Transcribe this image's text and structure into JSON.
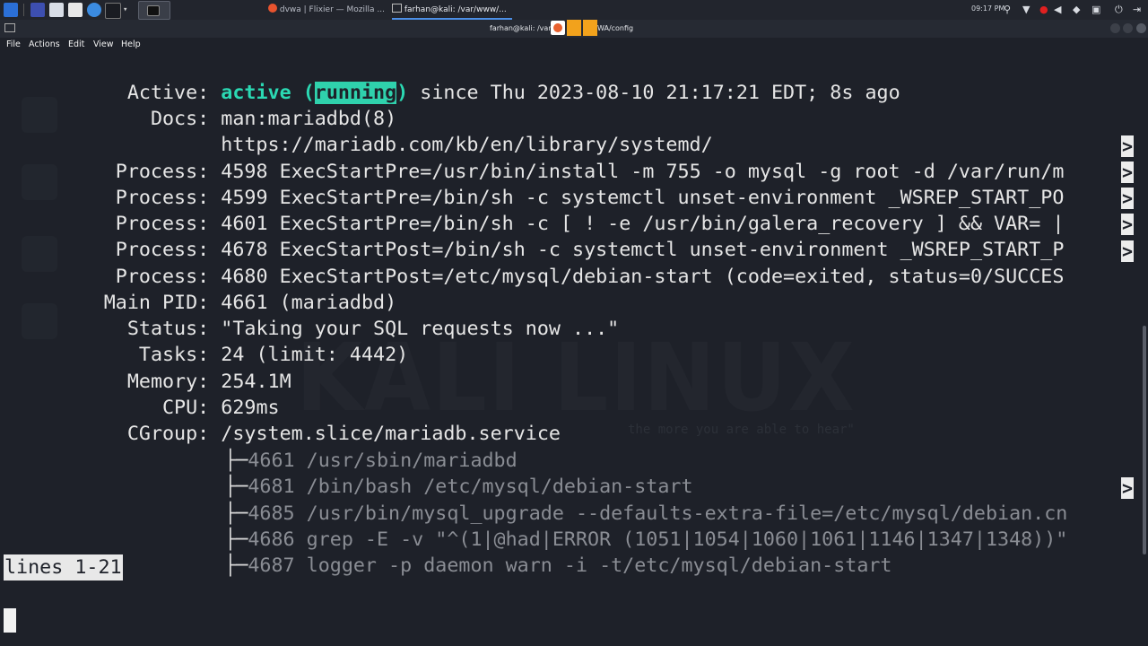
{
  "taskbar": {
    "tasks": [
      {
        "label": "dvwa | Flixier — Mozilla ..."
      },
      {
        "label": "farhan@kali: /var/www/..."
      }
    ],
    "clock": "09:17 PM"
  },
  "window": {
    "title_left": "farhan@kali: /var/",
    "title_right": "WA/config"
  },
  "menu": {
    "items": [
      "File",
      "Actions",
      "Edit",
      "View",
      "Help"
    ]
  },
  "terminal": {
    "active": {
      "key": "Active:",
      "state": "active",
      "paren_open": "(",
      "running": "running",
      "paren_close": ")",
      "rest": " since Thu 2023-08-10 21:17:21 EDT; 8s ago"
    },
    "docs": {
      "key": "Docs:",
      "value": "man:mariadbd(8)"
    },
    "docs_url": "https://mariadb.com/kb/en/library/systemd/",
    "processes": [
      {
        "key": "Process:",
        "value": "4598 ExecStartPre=/usr/bin/install -m 755 -o mysql -g root -d /var/run/m"
      },
      {
        "key": "Process:",
        "value": "4599 ExecStartPre=/bin/sh -c systemctl unset-environment _WSREP_START_PO"
      },
      {
        "key": "Process:",
        "value": "4601 ExecStartPre=/bin/sh -c [ ! -e /usr/bin/galera_recovery ] && VAR= |"
      },
      {
        "key": "Process:",
        "value": "4678 ExecStartPost=/bin/sh -c systemctl unset-environment _WSREP_START_P"
      },
      {
        "key": "Process:",
        "value": "4680 ExecStartPost=/etc/mysql/debian-start (code=exited, status=0/SUCCES"
      }
    ],
    "main_pid": {
      "key": "Main PID:",
      "value": "4661 (mariadbd)"
    },
    "status": {
      "key": "Status:",
      "value": "\"Taking your SQL requests now ...\""
    },
    "tasks": {
      "key": "Tasks:",
      "value": "24 (limit: 4442)"
    },
    "memory": {
      "key": "Memory:",
      "value": "254.1M"
    },
    "cpu": {
      "key": "CPU:",
      "value": "629ms"
    },
    "cgroup": {
      "key": "CGroup:",
      "value": "/system.slice/mariadb.service"
    },
    "tree": [
      {
        "branch": "├─",
        "value": "4661 /usr/sbin/mariadbd"
      },
      {
        "branch": "├─",
        "value": "4681 /bin/bash /etc/mysql/debian-start"
      },
      {
        "branch": "├─",
        "value": "4685 /usr/bin/mysql_upgrade --defaults-extra-file=/etc/mysql/debian.cn"
      },
      {
        "branch": "├─",
        "value": "4686 grep -E -v \"^(1|@had|ERROR (1051|1054|1060|1061|1146|1347|1348))\""
      },
      {
        "branch": "├─",
        "value": "4687 logger -p daemon warn -i -t/etc/mysql/debian-start"
      }
    ],
    "continuation_marker": ">",
    "pager_status": "lines 1-21",
    "watermark": "KALI LINUX",
    "watermark_sub": "the more you are able to hear\""
  }
}
